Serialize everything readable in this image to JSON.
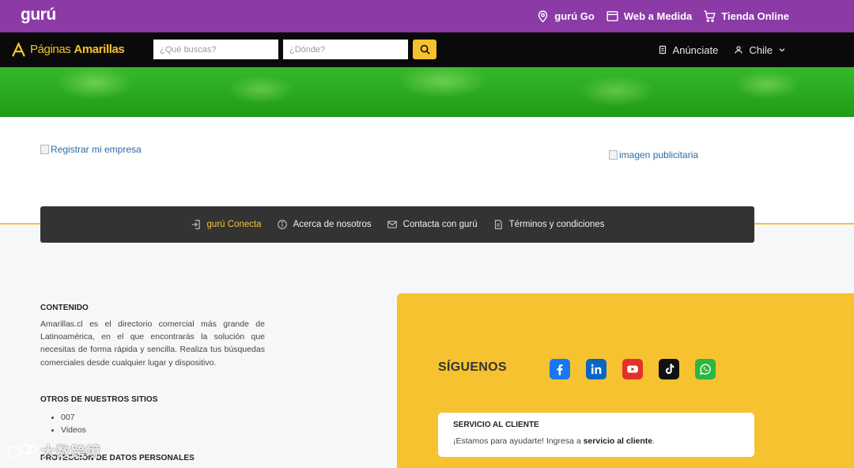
{
  "topbar": {
    "logo": "gurú",
    "links": [
      {
        "label": "gurú Go",
        "icon": "location-pin-icon"
      },
      {
        "label": "Web a Medida",
        "icon": "browser-window-icon"
      },
      {
        "label": "Tienda Online",
        "icon": "shopping-cart-icon"
      }
    ],
    "color": "#8b3aa6"
  },
  "navbar": {
    "logo_part1": "Páginas",
    "logo_part2": "Amarillas",
    "search_what_placeholder": "¿Qué buscas?",
    "search_where_placeholder": "¿Dónde?",
    "anunciate_label": "Anúnciate",
    "country_label": "Chile",
    "accent": "#f5c12e"
  },
  "banners": {
    "register_alt": "Registrar mi empresa",
    "ad_alt": "imagen publicitaria"
  },
  "footer_nav": [
    {
      "label": "gurú Conecta",
      "icon": "login-icon",
      "active": true
    },
    {
      "label": "Acerca de nosotros",
      "icon": "info-icon",
      "active": false
    },
    {
      "label": "Contacta con gurú",
      "icon": "mail-icon",
      "active": false
    },
    {
      "label": "Términos y condiciones",
      "icon": "document-icon",
      "active": false
    }
  ],
  "content": {
    "title": "CONTENIDO",
    "text": "Amarillas.cl es el directorio comercial más grande de Latinoamérica, en el que encontrarás la solución que necesitas de forma rápida y sencilla. Realiza tus búsquedas comerciales desde cualquier lugar y dispositivo.",
    "other_sites_title": "OTROS DE NUESTROS SITIOS",
    "other_sites": [
      "007",
      "Videos"
    ],
    "data_protection_title": "PROTECCIÓN DE DATOS PERSONALES"
  },
  "social": {
    "title": "SÍGUENOS",
    "networks": [
      "facebook",
      "linkedin",
      "youtube",
      "tiktok",
      "whatsapp"
    ]
  },
  "service": {
    "title": "SERVICIO AL CLIENTE",
    "text_prefix": "¡Estamos para ayudarte! Ingresa a ",
    "link": "servicio al cliente",
    "text_suffix": "."
  },
  "watermark": {
    "text": "大数跨境"
  }
}
